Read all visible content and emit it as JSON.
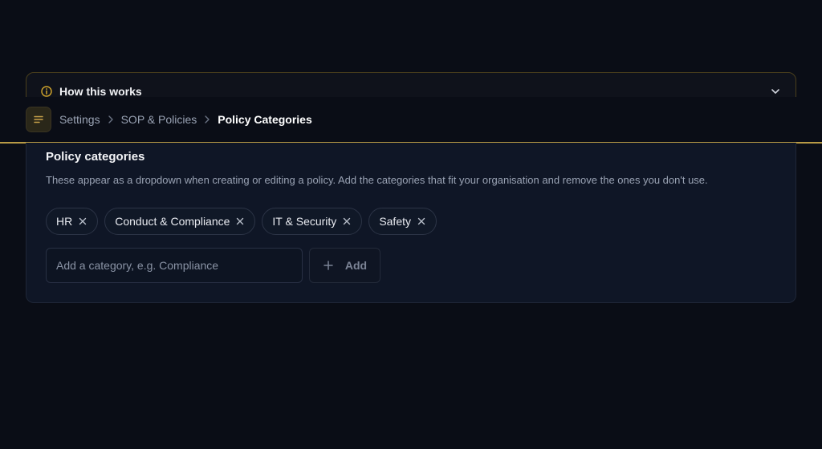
{
  "howto": {
    "title": "How this works"
  },
  "breadcrumb": {
    "items": [
      "Settings",
      "SOP & Policies"
    ],
    "current": "Policy Categories"
  },
  "card": {
    "title": "Policy categories",
    "description": "These appear as a dropdown when creating or editing a policy. Add the categories that fit your organisation and remove the ones you don't use.",
    "categories": [
      "HR",
      "Conduct & Compliance",
      "IT & Security",
      "Safety"
    ],
    "input_placeholder": "Add a category, e.g. Compliance",
    "input_value": "",
    "add_label": "Add"
  },
  "colors": {
    "accent_gold": "#b89a45",
    "background": "#0a0d16",
    "card_background": "#0f1626"
  },
  "icons": [
    "info-icon",
    "chevron-down-icon",
    "menu-icon",
    "chevron-right-icon",
    "close-icon",
    "plus-icon"
  ]
}
